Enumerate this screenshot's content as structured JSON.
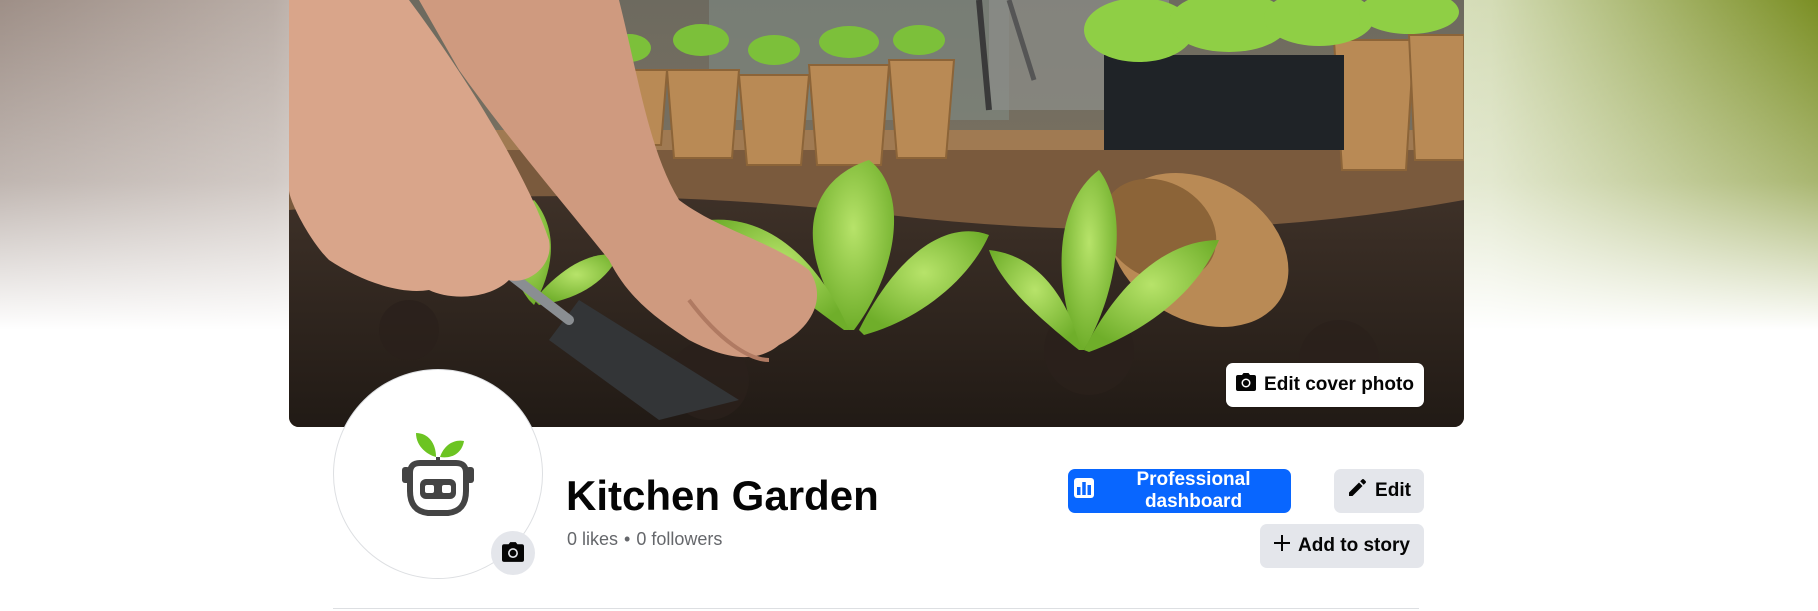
{
  "cover": {
    "edit_cover_label": "Edit cover photo",
    "edit_cover_icon": "camera-icon"
  },
  "profile": {
    "name": "Kitchen Garden",
    "likes": "0 likes",
    "separator": "•",
    "followers": "0 followers",
    "avatar_icon": "sprout-robot-logo",
    "avatar_camera_icon": "camera-icon"
  },
  "actions": {
    "dashboard_label": "Professional dashboard",
    "dashboard_icon": "bar-chart-icon",
    "edit_label": "Edit",
    "edit_icon": "pencil-icon",
    "story_label": "Add to story",
    "story_icon": "plus-icon"
  },
  "colors": {
    "primary": "#0866ff",
    "secondary_bg": "#e4e6eb",
    "text": "#050505",
    "muted": "#65676b",
    "logo_leaf": "#6cc422",
    "logo_body": "#444444"
  }
}
